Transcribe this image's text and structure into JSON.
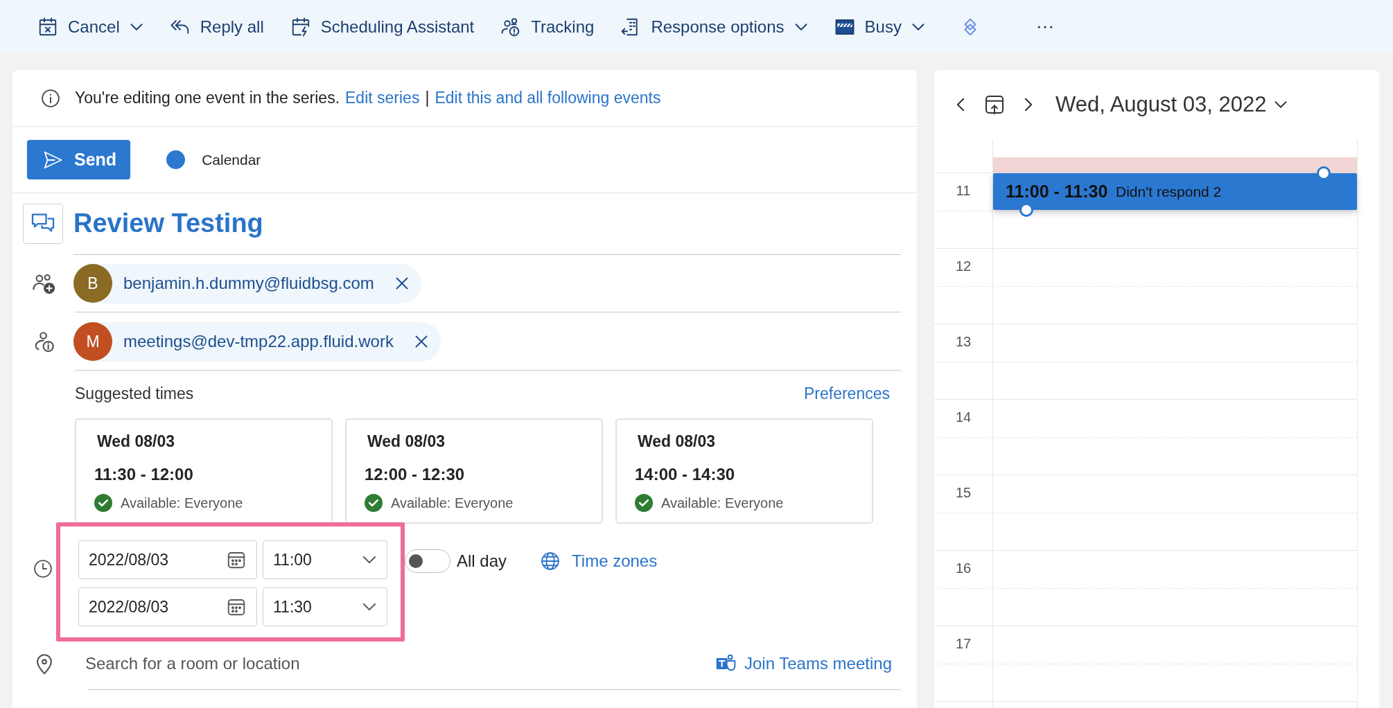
{
  "toolbar": {
    "items": [
      {
        "label": "Cancel",
        "dropdown": true
      },
      {
        "label": "Reply all",
        "dropdown": false
      },
      {
        "label": "Scheduling Assistant",
        "dropdown": false
      },
      {
        "label": "Tracking",
        "dropdown": false
      },
      {
        "label": "Response options",
        "dropdown": true
      },
      {
        "label": "Busy",
        "dropdown": true
      }
    ]
  },
  "notice": {
    "text": "You're editing one event in the series.",
    "links": [
      {
        "label": "Edit series"
      },
      {
        "label": "Edit this and all following events"
      }
    ],
    "separator": "|"
  },
  "send": {
    "label": "Send"
  },
  "calendar_pick": {
    "label": "Calendar",
    "color": "#2b78d0"
  },
  "title": "Review Testing",
  "attendees": [
    {
      "kind": "required",
      "initial": "B",
      "email": "benjamin.h.dummy@fluidbsg.com",
      "color": "#8b6a23"
    },
    {
      "kind": "optional",
      "initial": "M",
      "email": "meetings@dev-tmp22.app.fluid.work",
      "color": "#c14f22"
    }
  ],
  "suggested": {
    "label": "Suggested times",
    "preferences": "Preferences",
    "cards": [
      {
        "day": "Wed 08/03",
        "time": "11:30 - 12:00",
        "availability": "Available: Everyone"
      },
      {
        "day": "Wed 08/03",
        "time": "12:00 - 12:30",
        "availability": "Available: Everyone"
      },
      {
        "day": "Wed 08/03",
        "time": "14:00 - 14:30",
        "availability": "Available: Everyone"
      }
    ]
  },
  "when": {
    "rows": [
      {
        "date": "2022/08/03",
        "time": "11:00"
      },
      {
        "date": "2022/08/03",
        "time": "11:30"
      }
    ],
    "all_day": {
      "label": "All day",
      "on": false
    },
    "time_zones": "Time zones"
  },
  "location": {
    "placeholder": "Search for a room or location",
    "teams": "Join Teams meeting"
  },
  "day_view": {
    "date": "Wed, August 03, 2022",
    "hours": [
      "11",
      "12",
      "13",
      "14",
      "15",
      "16",
      "17"
    ],
    "event": {
      "time": "11:00 - 11:30",
      "title": "Didn't respond 2"
    }
  }
}
